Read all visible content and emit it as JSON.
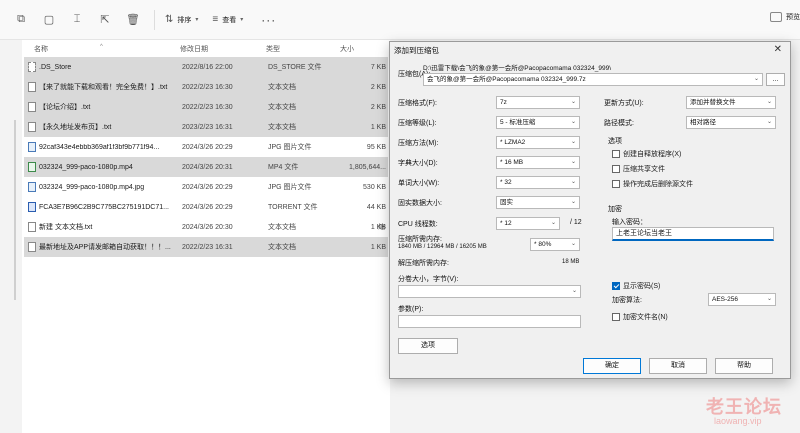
{
  "toolbar": {
    "sort_label": "排序",
    "view_label": "查看",
    "more_label": "···",
    "right_label": "预览"
  },
  "columns": {
    "name": "名称",
    "date": "修改日期",
    "type": "类型",
    "size": "大小"
  },
  "files": [
    {
      "name": ".DS_Store",
      "date": "2022/8/16 22:00",
      "type": "DS_STORE 文件",
      "size": "7 KB",
      "selected": true,
      "kind": "ds"
    },
    {
      "name": "【来了就能下载和观看！完全免费！】.txt",
      "date": "2022/2/23 16:30",
      "type": "文本文档",
      "size": "2 KB",
      "selected": true,
      "kind": "txt"
    },
    {
      "name": "【论坛介绍】.txt",
      "date": "2022/2/23 16:30",
      "type": "文本文档",
      "size": "2 KB",
      "selected": true,
      "kind": "txt"
    },
    {
      "name": "【永久地址发布页】.txt",
      "date": "2023/2/23 16:31",
      "type": "文本文档",
      "size": "1 KB",
      "selected": true,
      "kind": "txt"
    },
    {
      "name": "92caf343e4ebbb369af1f3bf9b771f94...",
      "date": "2024/3/26 20:29",
      "type": "JPG 图片文件",
      "size": "95 KB",
      "selected": false,
      "kind": "img"
    },
    {
      "name": "032324_999-paco-1080p.mp4",
      "date": "2024/3/26 20:31",
      "type": "MP4 文件",
      "size": "1,805,644...",
      "selected": true,
      "kind": "mp4"
    },
    {
      "name": "032324_999-paco-1080p.mp4.jpg",
      "date": "2024/3/26 20:29",
      "type": "JPG 图片文件",
      "size": "530 KB",
      "selected": false,
      "kind": "img"
    },
    {
      "name": "FCA3E7B96C2B9C775BC275191DC71...",
      "date": "2024/3/26 20:29",
      "type": "TORRENT 文件",
      "size": "44 KB",
      "selected": false,
      "kind": "tor"
    },
    {
      "name": "新建 文本文档.txt",
      "date": "2024/3/26 20:30",
      "type": "文本文档",
      "size": "1 KB",
      "selected": false,
      "kind": "txt"
    },
    {
      "name": "最新地址及APP请发邮箱自动获取！！！...",
      "date": "2022/2/23 16:31",
      "type": "文本文档",
      "size": "1 KB",
      "selected": true,
      "kind": "txt"
    }
  ],
  "dialog": {
    "title": "添加到压缩包",
    "archive_label": "压缩包(A):",
    "archive_path": "D:\\迅雷下载\\会飞的象@第一会所@Pacopacomama 032324_999\\",
    "archive_name": "会飞的象@第一会所@Pacopacomama 032324_999.7z",
    "browse_label": "...",
    "format_label": "压缩格式(F):",
    "format_value": "7z",
    "level_label": "压缩等级(L):",
    "level_value": "5 - 标准压缩",
    "method_label": "压缩方法(M):",
    "method_value": "* LZMA2",
    "dict_label": "字典大小(D):",
    "dict_value": "* 16 MB",
    "word_label": "单词大小(W):",
    "word_value": "* 32",
    "solid_label": "固实数据大小:",
    "solid_value": "固实",
    "threads_label": "CPU 线程数:",
    "threads_value": "* 12",
    "threads_total": "/ 12",
    "mem_label": "压缩所需内存:",
    "mem_value": "1840 MB / 12964 MB / 16205 MB",
    "mem_pct": "* 80%",
    "decomp_label": "解压缩所需内存:",
    "decomp_value": "18 MB",
    "split_label": "分卷大小，字节(V):",
    "split_value": "",
    "params_label": "参数(P):",
    "params_value": "",
    "options_btn": "选项",
    "update_label": "更新方式(U):",
    "update_value": "添加并替换文件",
    "pathmode_label": "路径模式:",
    "pathmode_value": "相对路径",
    "options_group": "选项",
    "opt_sfx": "创建自释放程序(X)",
    "opt_shared": "压缩共享文件",
    "opt_delete": "操作完成后删除源文件",
    "encrypt_group": "加密",
    "pw_label": "输入密码：",
    "pw_value": "上老王论坛当老王",
    "show_pw": "显示密码(S)",
    "enc_method_label": "加密算法:",
    "enc_method_value": "AES-256",
    "enc_names": "加密文件名(N)",
    "ok": "确定",
    "cancel": "取消",
    "help": "帮助"
  },
  "watermark": {
    "line1": "老王论坛",
    "line2": "laowang.vip"
  },
  "side_stub": "缩"
}
